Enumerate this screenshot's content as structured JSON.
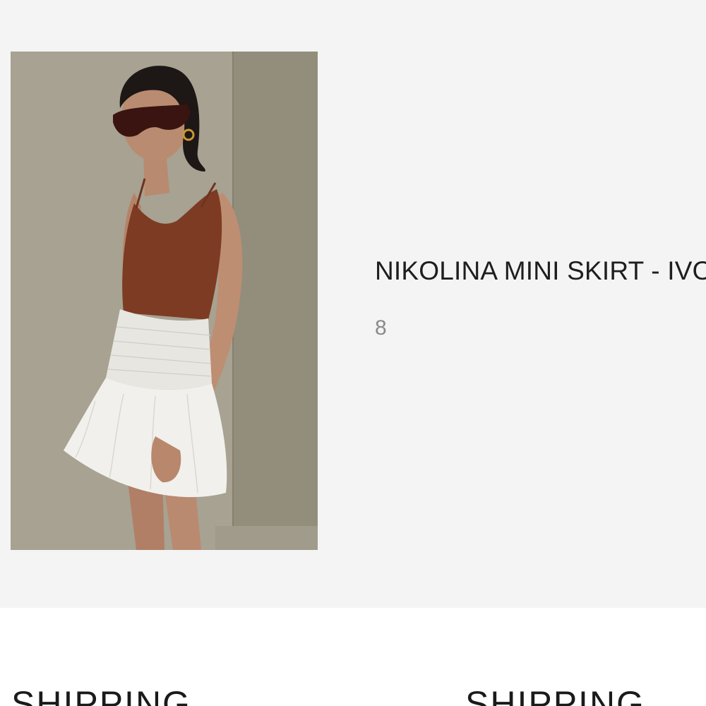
{
  "product": {
    "title": "NIKOLINA MINI SKIRT - IVORY",
    "meta": "8",
    "image_alt": "Model wearing rust knit cami and ivory smocked mini skirt"
  },
  "lower": {
    "heading_left": "SHIPPING",
    "heading_right": "SHIPPING"
  },
  "colors": {
    "panel_bg": "#f4f4f4",
    "page_bg": "#ffffff",
    "title": "#1e1e1e",
    "meta": "#8a8a8a"
  }
}
